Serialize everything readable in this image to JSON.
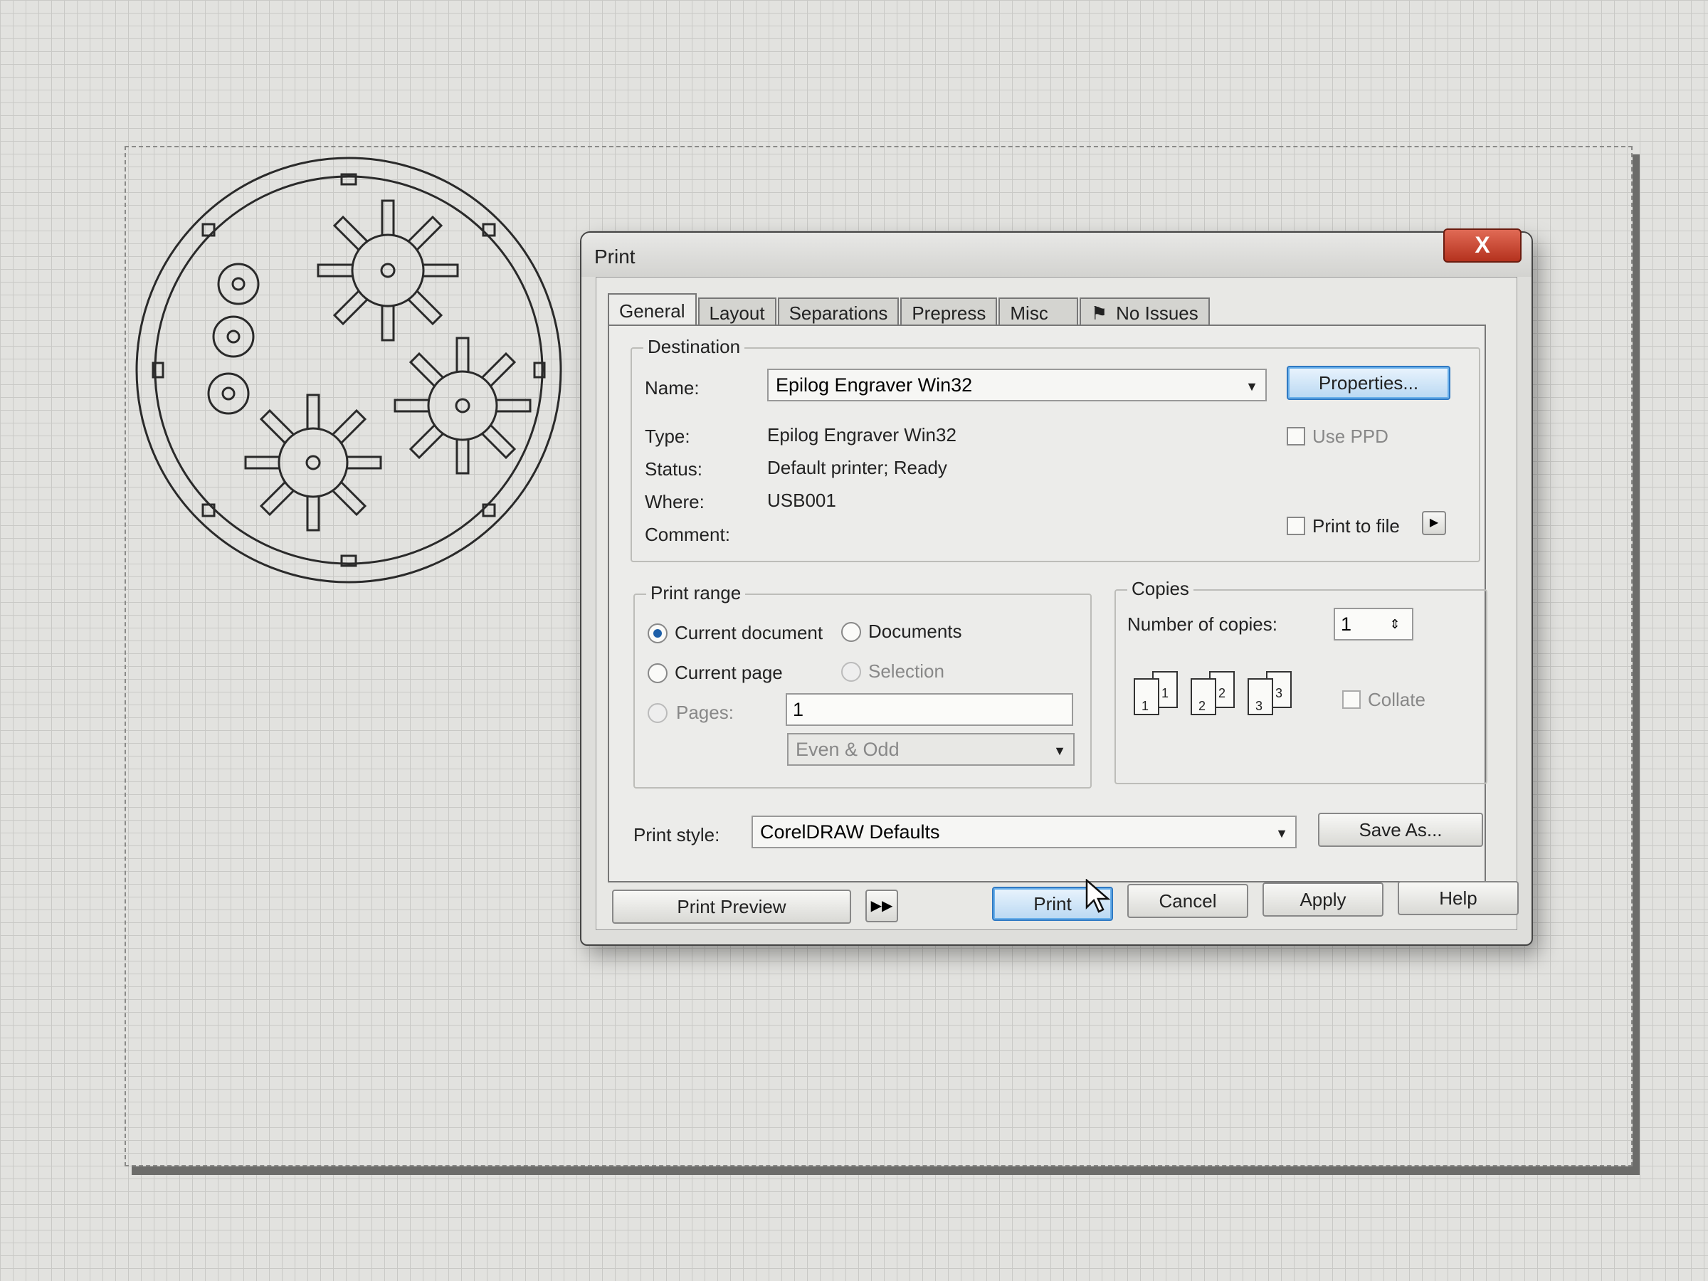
{
  "dialog": {
    "title": "Print",
    "close_label": "X",
    "tabs": [
      "General",
      "Layout",
      "Separations",
      "Prepress",
      "Misc",
      "No Issues"
    ],
    "active_tab": "General",
    "destination": {
      "legend": "Destination",
      "name_label": "Name:",
      "name_value": "Epilog Engraver Win32",
      "properties_label": "Properties...",
      "type_label": "Type:",
      "type_value": "Epilog Engraver Win32",
      "status_label": "Status:",
      "status_value": "Default printer; Ready",
      "where_label": "Where:",
      "where_value": "USB001",
      "comment_label": "Comment:",
      "use_ppd_label": "Use PPD",
      "print_to_file_label": "Print to file"
    },
    "print_range": {
      "legend": "Print range",
      "current_document": "Current document",
      "documents": "Documents",
      "current_page": "Current page",
      "selection": "Selection",
      "pages_label": "Pages:",
      "pages_value": "1",
      "parity_value": "Even & Odd"
    },
    "copies": {
      "legend": "Copies",
      "number_label": "Number of copies:",
      "number_value": "1",
      "collate_label": "Collate"
    },
    "print_style": {
      "label": "Print style:",
      "value": "CorelDRAW Defaults",
      "save_as_label": "Save As..."
    },
    "buttons": {
      "print_preview": "Print Preview",
      "print": "Print",
      "cancel": "Cancel",
      "apply": "Apply",
      "help": "Help"
    }
  }
}
